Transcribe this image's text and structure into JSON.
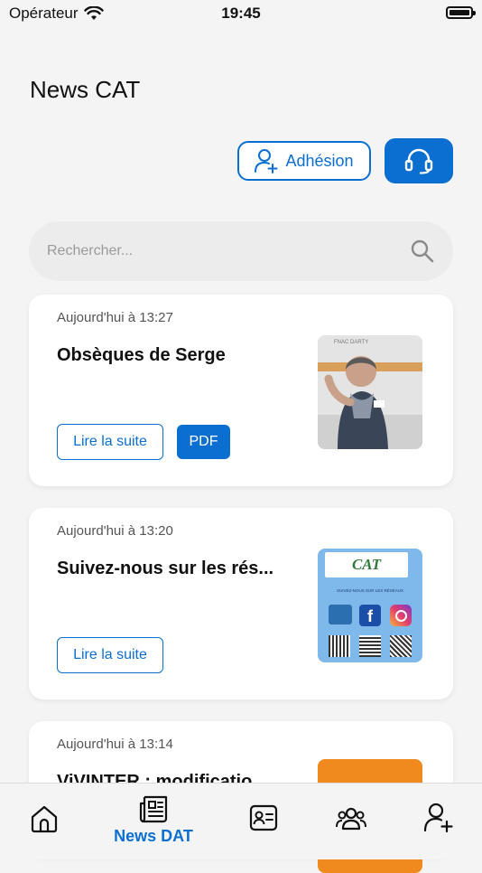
{
  "status_bar": {
    "carrier": "Opérateur",
    "time": "19:45"
  },
  "header": {
    "title": "News CAT"
  },
  "actions": {
    "adhesion_label": "Adhésion"
  },
  "search": {
    "placeholder": "Rechercher..."
  },
  "news": [
    {
      "date": "Aujourd'hui à 13:27",
      "title": "Obsèques de Serge",
      "read_more": "Lire la suite",
      "pdf": "PDF",
      "thumb_caption": "FNAC DARTY"
    },
    {
      "date": "Aujourd'hui à 13:20",
      "title": "Suivez-nous sur les rés...",
      "read_more": "Lire la suite",
      "thumb_caption": "CAT",
      "thumb_subtitle": "SUIVEZ-NOUS SUR LES RÉSEAUX"
    },
    {
      "date": "Aujourd'hui à 13:14",
      "title": "ViVINTER : modificatio"
    }
  ],
  "tabbar": {
    "active_label": "News DAT"
  },
  "colors": {
    "accent": "#0a6fd1",
    "background": "#f4f4f4",
    "thumb_orange": "#f08a1e"
  }
}
